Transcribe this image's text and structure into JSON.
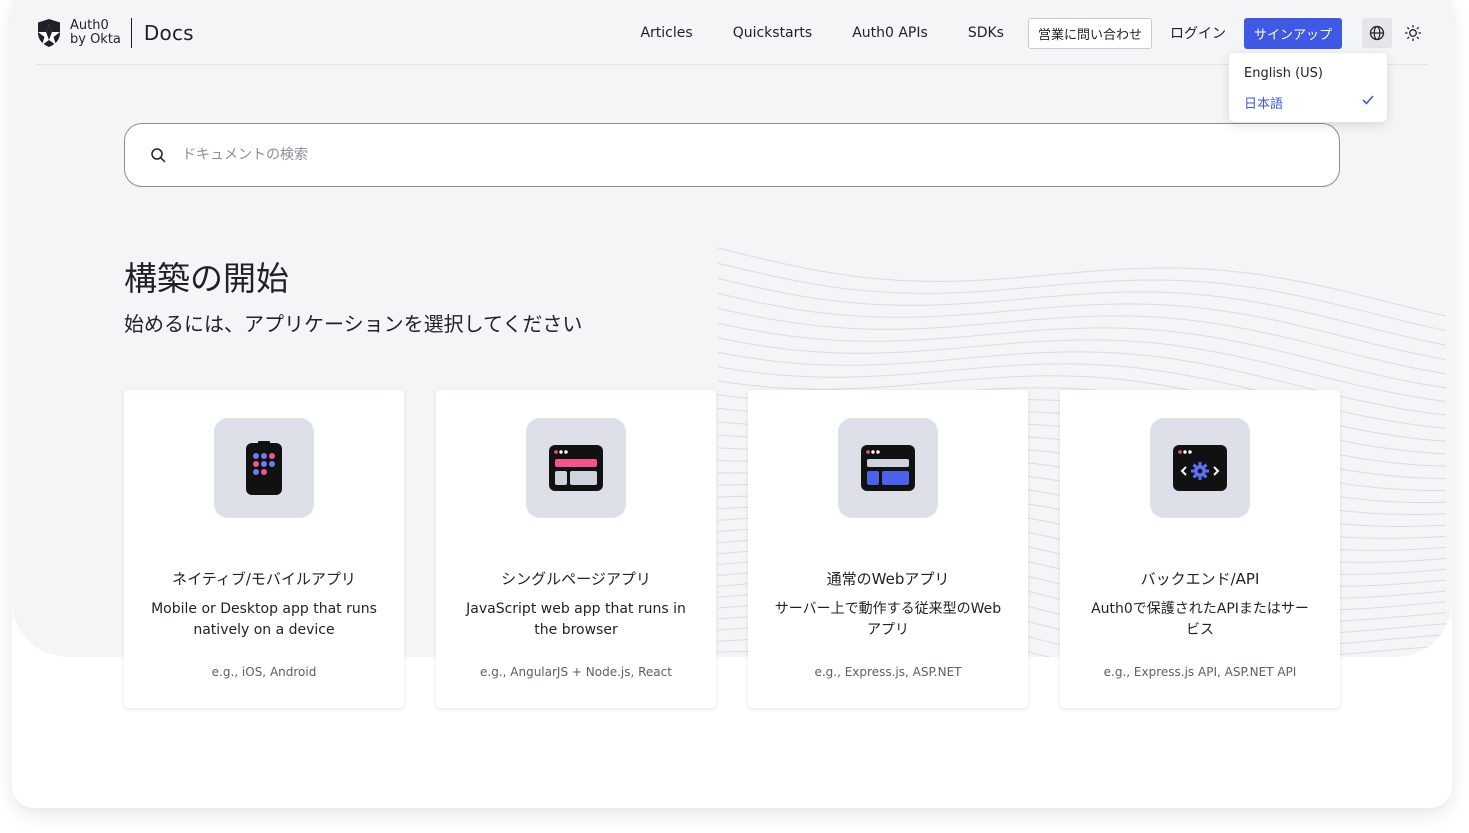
{
  "header": {
    "logo_line1": "Auth0",
    "logo_line2": "by Okta",
    "docs_label": "Docs",
    "nav": [
      {
        "label": "Articles"
      },
      {
        "label": "Quickstarts"
      },
      {
        "label": "Auth0 APIs"
      },
      {
        "label": "SDKs"
      }
    ],
    "contact_sales_label": "営業に問い合わせ",
    "login_label": "ログイン",
    "signup_label": "サインアップ",
    "language_icon": "globe-icon",
    "theme_icon": "sun-icon"
  },
  "language_menu": {
    "items": [
      {
        "label": "English (US)",
        "selected": false
      },
      {
        "label": "日本語",
        "selected": true
      }
    ]
  },
  "search": {
    "placeholder": "ドキュメントの検索",
    "value": ""
  },
  "main": {
    "title": "構築の開始",
    "subtitle": "始めるには、アプリケーションを選択してください"
  },
  "cards": [
    {
      "title": "ネイティブ/モバイルアプリ",
      "description": "Mobile or Desktop app that runs natively on a device",
      "example": "e.g., iOS, Android",
      "icon": "mobile-app-icon"
    },
    {
      "title": "シングルページアプリ",
      "description": "JavaScript web app that runs in the browser",
      "example": "e.g., AngularJS + Node.js, React",
      "icon": "single-page-app-icon"
    },
    {
      "title": "通常のWebアプリ",
      "description": "サーバー上で動作する従来型のWebアプリ",
      "example": "e.g., Express.js, ASP.NET",
      "icon": "web-app-icon"
    },
    {
      "title": "バックエンド/API",
      "description": "Auth0で保護されたAPIまたはサービス",
      "example": "e.g., Express.js API, ASP.NET API",
      "icon": "backend-api-icon"
    }
  ],
  "colors": {
    "accent": "#3f59e4",
    "hero_background": "#f4f5f7",
    "text": "#1e212a",
    "icon_tile": "#dde0e8"
  }
}
